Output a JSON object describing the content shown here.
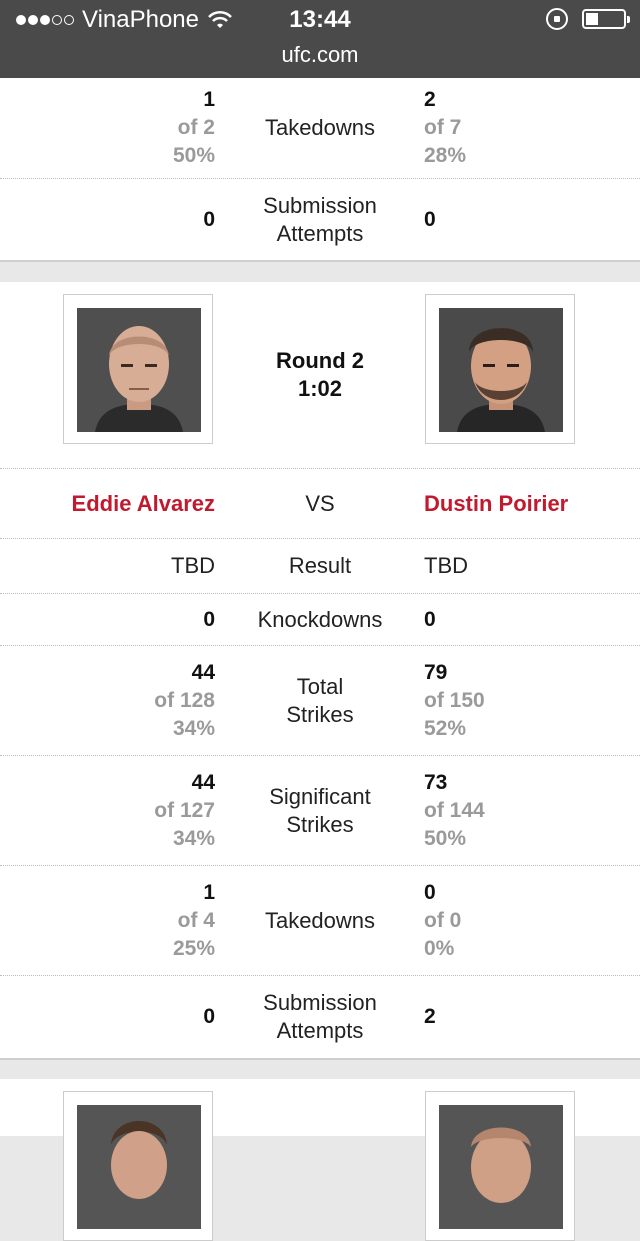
{
  "status_bar": {
    "carrier": "VinaPhone",
    "time": "13:44",
    "url": "ufc.com"
  },
  "top_card": {
    "takedowns": {
      "label": "Takedowns",
      "left": [
        "1",
        "of 2",
        "50%"
      ],
      "right": [
        "2",
        "of 7",
        "28%"
      ]
    },
    "submissions": {
      "label": "Submission Attempts",
      "left": "0",
      "right": "0"
    }
  },
  "round2": {
    "round_label": "Round 2",
    "round_time": "1:02",
    "fighter_left": "Eddie Alvarez",
    "vs": "VS",
    "fighter_right": "Dustin Poirier",
    "result": {
      "label": "Result",
      "left": "TBD",
      "right": "TBD"
    },
    "knockdowns": {
      "label": "Knockdowns",
      "left": "0",
      "right": "0"
    },
    "total_strikes": {
      "label": "Total Strikes",
      "left": [
        "44",
        "of 128",
        "34%"
      ],
      "right": [
        "79",
        "of 150",
        "52%"
      ]
    },
    "sig_strikes": {
      "label": "Significant Strikes",
      "left": [
        "44",
        "of 127",
        "34%"
      ],
      "right": [
        "73",
        "of 144",
        "50%"
      ]
    },
    "takedowns": {
      "label": "Takedowns",
      "left": [
        "1",
        "of 4",
        "25%"
      ],
      "right": [
        "0",
        "of 0",
        "0%"
      ]
    },
    "submissions": {
      "label": "Submission Attempts",
      "left": "0",
      "right": "2"
    }
  }
}
